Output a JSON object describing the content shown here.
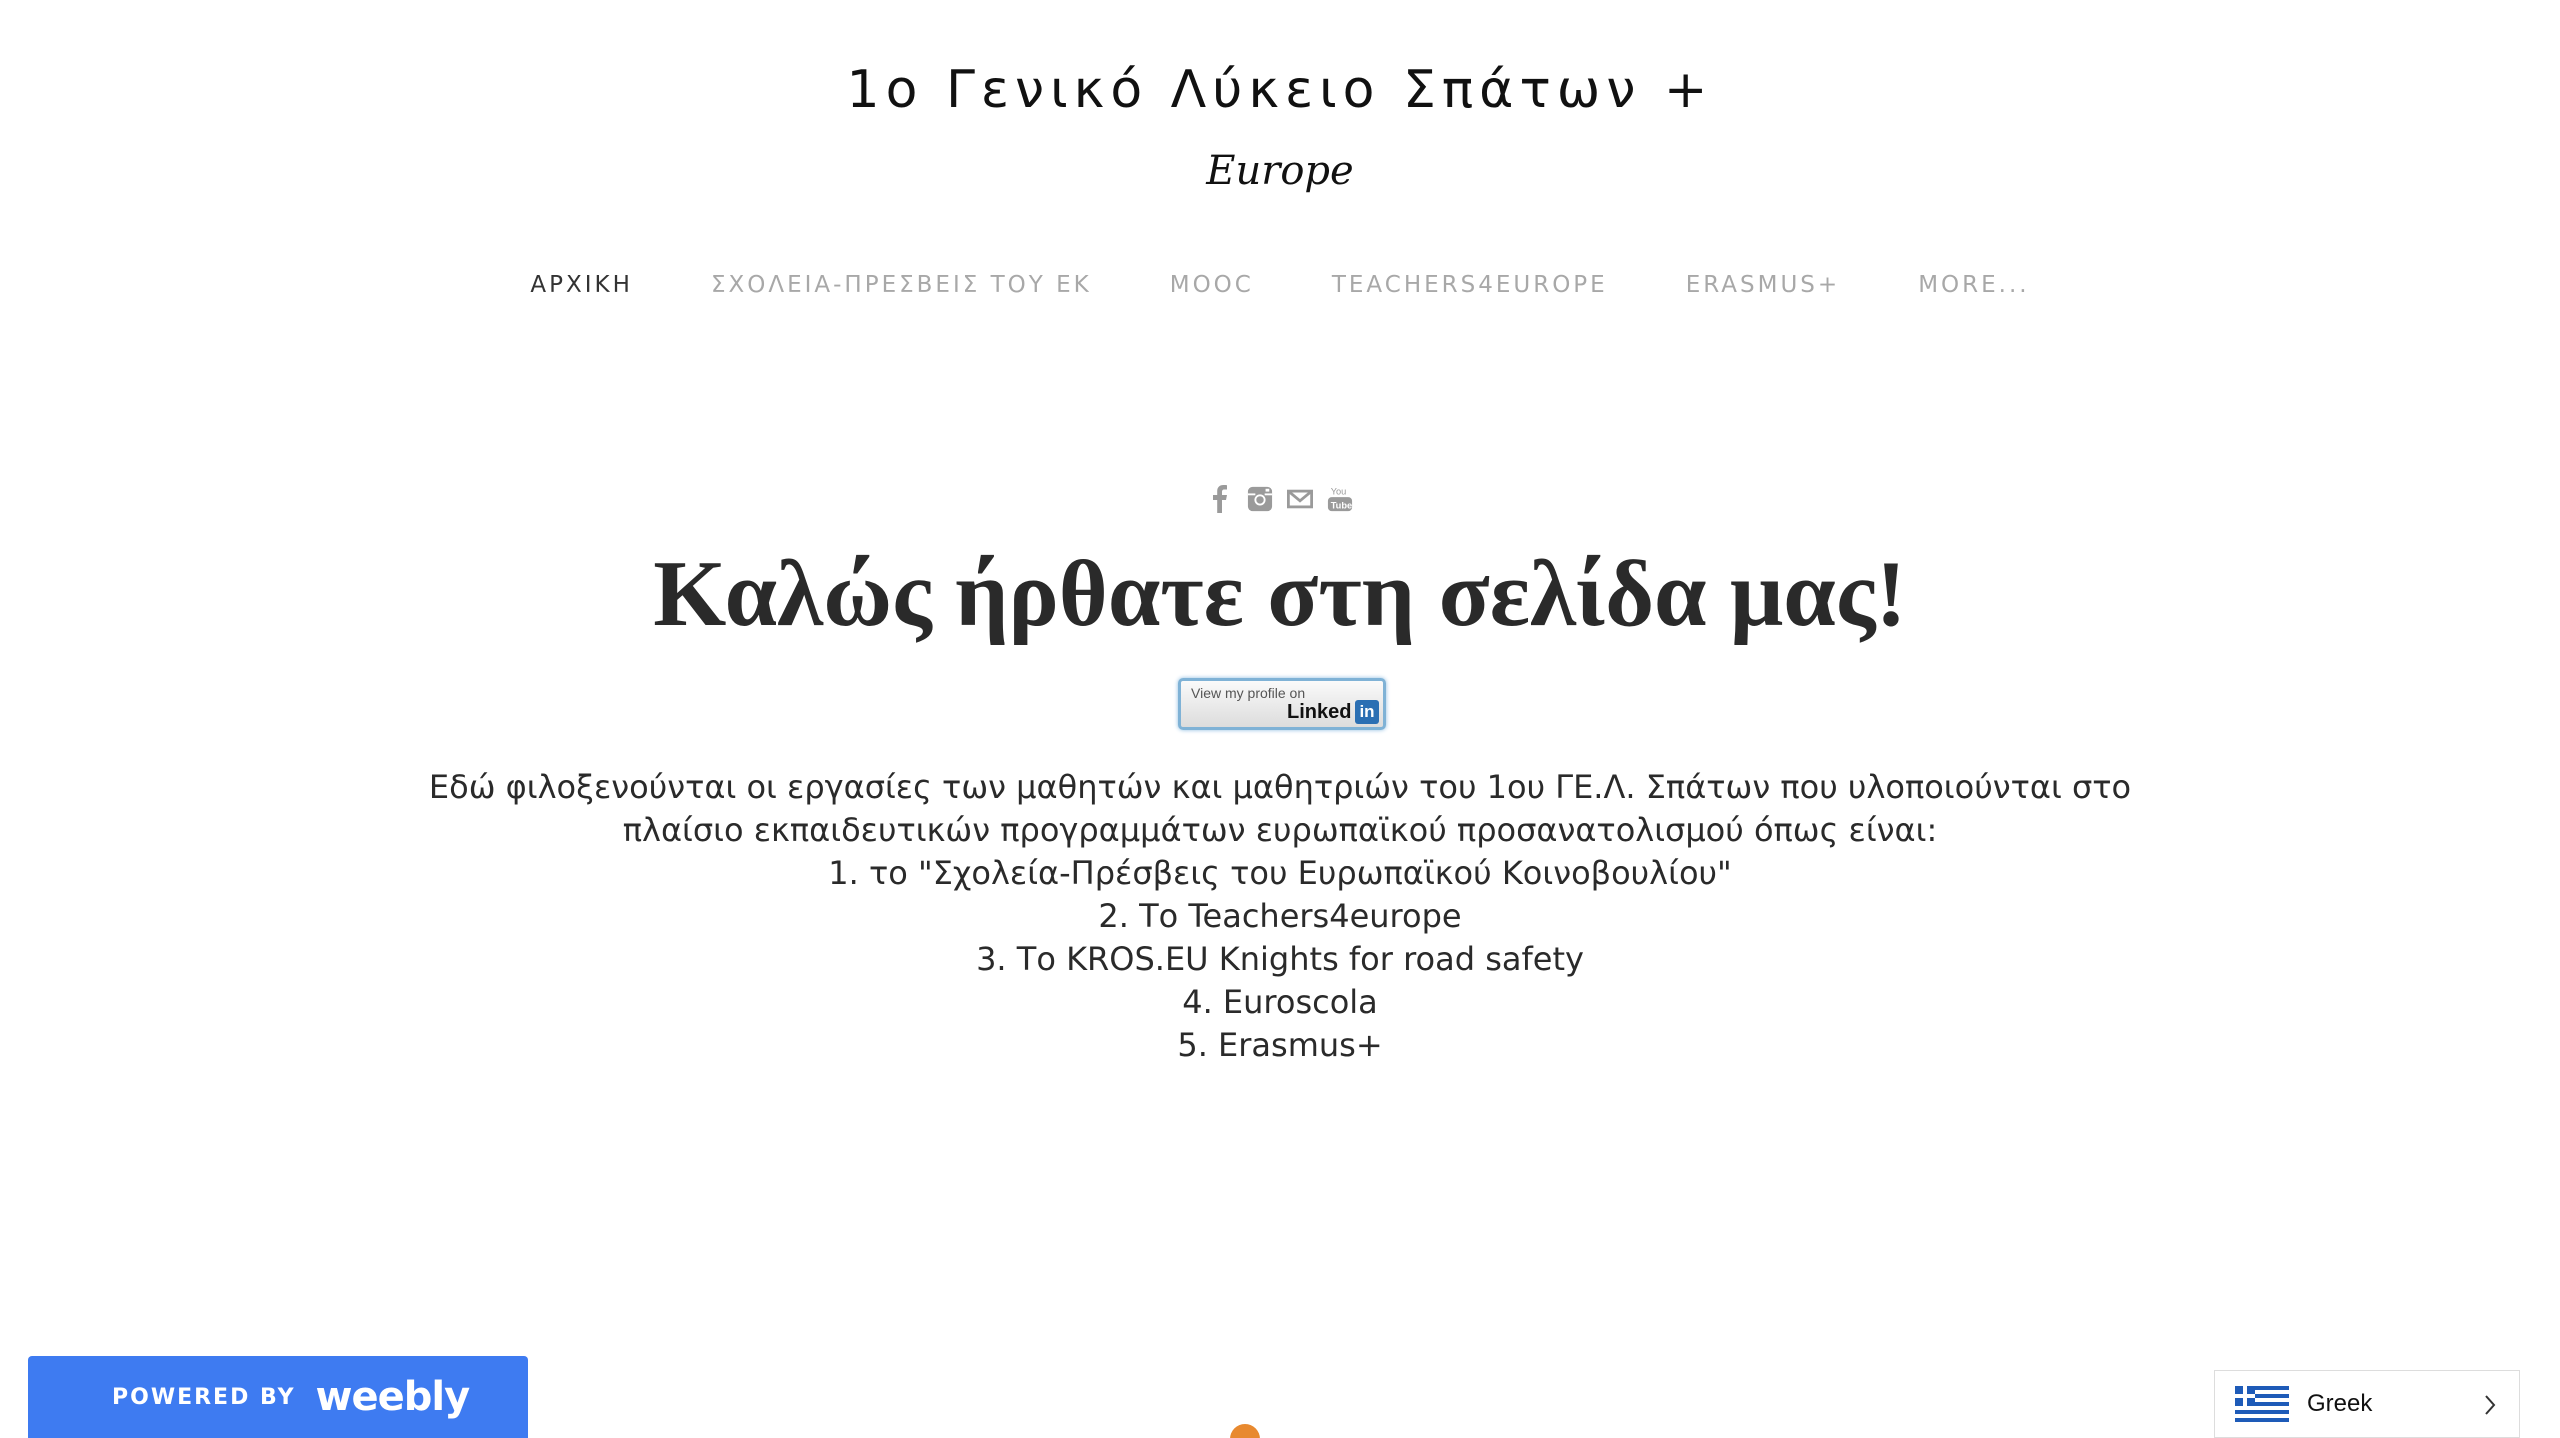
{
  "header": {
    "title": "1ο Γενικό Λύκειο Σπάτων +",
    "subtitle": "Europe"
  },
  "nav": {
    "items": [
      {
        "label": "ΑΡΧΙΚΗ",
        "active": true
      },
      {
        "label": "ΣΧΟΛΕΙΑ-ΠΡΕΣΒΕΙΣ ΤΟΥ ΕΚ",
        "active": false
      },
      {
        "label": "MOOC",
        "active": false
      },
      {
        "label": "TEACHERS4EUROPE",
        "active": false
      },
      {
        "label": "ERASMUS+",
        "active": false
      },
      {
        "label": "MORE...",
        "active": false
      }
    ]
  },
  "social": {
    "icons": [
      "facebook-icon",
      "instagram-icon",
      "mail-icon",
      "youtube-icon"
    ]
  },
  "main": {
    "headline": "Καλώς ήρθατε στη σελίδα μας!",
    "linkedin_badge": {
      "line1": "View my profile on",
      "line2": "Linked",
      "line3": "in"
    },
    "intro": [
      "Εδώ φιλοξενούνται οι εργασίες των μαθητών και μαθητριών του 1ου ΓΕ.Λ. Σπάτων που υλοποιούνται στο πλαίσιο εκπαιδευτικών προγραμμάτων ευρωπαϊκού προσανατολισμού όπως είναι:",
      "1. το \"Σχολεία-Πρέσβεις του Ευρωπαϊκού Κοινοβουλίου\"",
      "2. Το Teachers4europe",
      "3. Το KROS.EU Knights for road safety",
      "4. Euroscola",
      "5. Erasmus+"
    ]
  },
  "footer": {
    "powered_by": "POWERED BY",
    "brand": "weebly"
  },
  "language_selector": {
    "value": "Greek"
  },
  "colors": {
    "nav_inactive": "#a8a8a8",
    "nav_active": "#333333",
    "weebly_blue": "#3e7bf1",
    "accent_orange": "#e8892f"
  }
}
